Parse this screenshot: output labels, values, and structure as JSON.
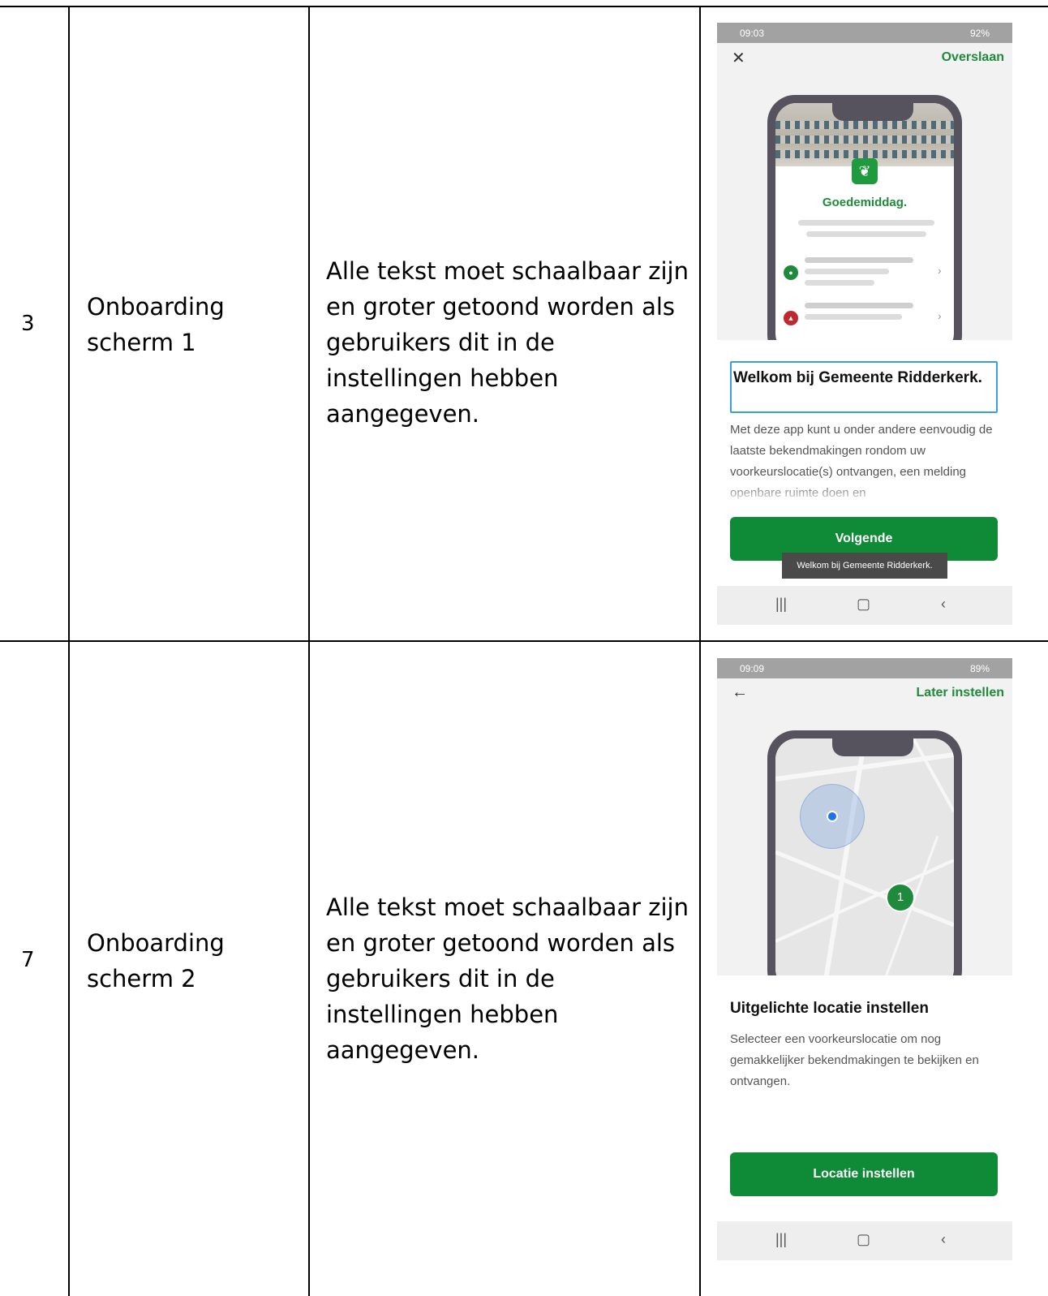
{
  "rows": [
    {
      "number": "3",
      "name": "Onboarding scherm 1",
      "description": "Alle tekst moet schaalbaar zijn en groter getoond worden als gebruikers dit in de instellingen hebben aangegeven.",
      "screen": {
        "status_time": "09:03",
        "status_right": "92%",
        "action": "Overslaan",
        "greeting": "Goedemiddag.",
        "heading": "Welkom bij Gemeente Ridderkerk.",
        "body": "Met deze app kunt u onder andere eenvoudig de laatste bekendmakingen rondom uw voorkeurslocatie(s) ontvangen, een melding openbare ruimte doen en",
        "button": "Volgende",
        "toast": "Welkom bij Gemeente Ridderkerk."
      }
    },
    {
      "number": "7",
      "name": "Onboarding scherm 2",
      "description": "Alle tekst moet schaalbaar zijn en groter getoond worden als gebruikers dit in de instellingen hebben aangegeven.",
      "screen": {
        "status_time": "09:09",
        "status_right": "89%",
        "action": "Later instellen",
        "map_pin_count": "1",
        "heading": "Uitgelichte locatie instellen",
        "body": "Selecteer een voorkeurslocatie om nog gemakkelijker bekendmakingen te bekijken en ontvangen.",
        "button": "Locatie instellen"
      }
    }
  ],
  "icons": {
    "close": "close-icon",
    "back": "back-arrow-icon",
    "nav_recent": "recent-apps-icon",
    "nav_home": "home-icon",
    "nav_back": "nav-back-icon"
  },
  "colors": {
    "brand_green": "#0f8a36",
    "focus_outline": "#3a9fd8"
  }
}
